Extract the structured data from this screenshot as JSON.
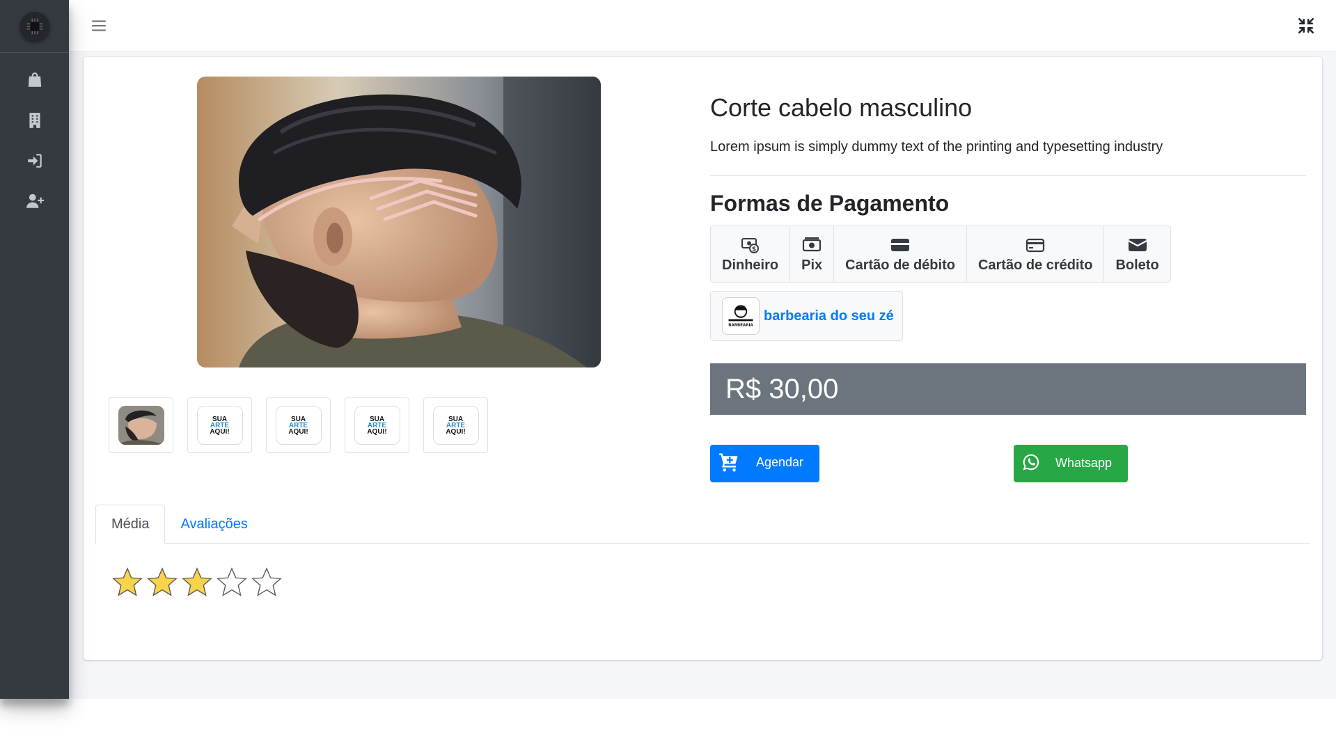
{
  "product": {
    "title": "Corte cabelo masculino",
    "description": "Lorem ipsum is simply dummy text of the printing and typesetting industry",
    "price": "R$ 30,00"
  },
  "thumbnails": [
    {
      "kind": "photo"
    },
    {
      "kind": "placeholder",
      "line1": "SUA",
      "line2": "ARTE",
      "line3": "AQUI!"
    },
    {
      "kind": "placeholder",
      "line1": "SUA",
      "line2": "ARTE",
      "line3": "AQUI!"
    },
    {
      "kind": "placeholder",
      "line1": "SUA",
      "line2": "ARTE",
      "line3": "AQUI!"
    },
    {
      "kind": "placeholder",
      "line1": "SUA",
      "line2": "ARTE",
      "line3": "AQUI!"
    }
  ],
  "payment": {
    "title": "Formas de Pagamento",
    "methods": [
      {
        "label": "Dinheiro",
        "icon": "money-icon"
      },
      {
        "label": "Pix",
        "icon": "pix-icon"
      },
      {
        "label": "Cartão de débito",
        "icon": "debit-card-icon"
      },
      {
        "label": "Cartão de crédito",
        "icon": "credit-card-icon"
      },
      {
        "label": "Boleto",
        "icon": "boleto-icon"
      }
    ]
  },
  "store": {
    "name": "barbearia do seu zé",
    "logo_text": "BARBEARIA"
  },
  "actions": {
    "schedule_label": "Agendar",
    "whatsapp_label": "Whatsapp"
  },
  "tabs": [
    {
      "label": "Média",
      "active": true
    },
    {
      "label": "Avaliações",
      "active": false
    }
  ],
  "rating": {
    "value": 3,
    "max": 5,
    "star_color": "#f9d44a"
  },
  "sidebar": {
    "icons": [
      "shopping-bag-icon",
      "building-icon",
      "sign-in-icon",
      "user-plus-icon"
    ]
  },
  "colors": {
    "primary": "#007bff",
    "success": "#28a745",
    "secondary": "#6c757d",
    "sidebar": "#343a40"
  }
}
